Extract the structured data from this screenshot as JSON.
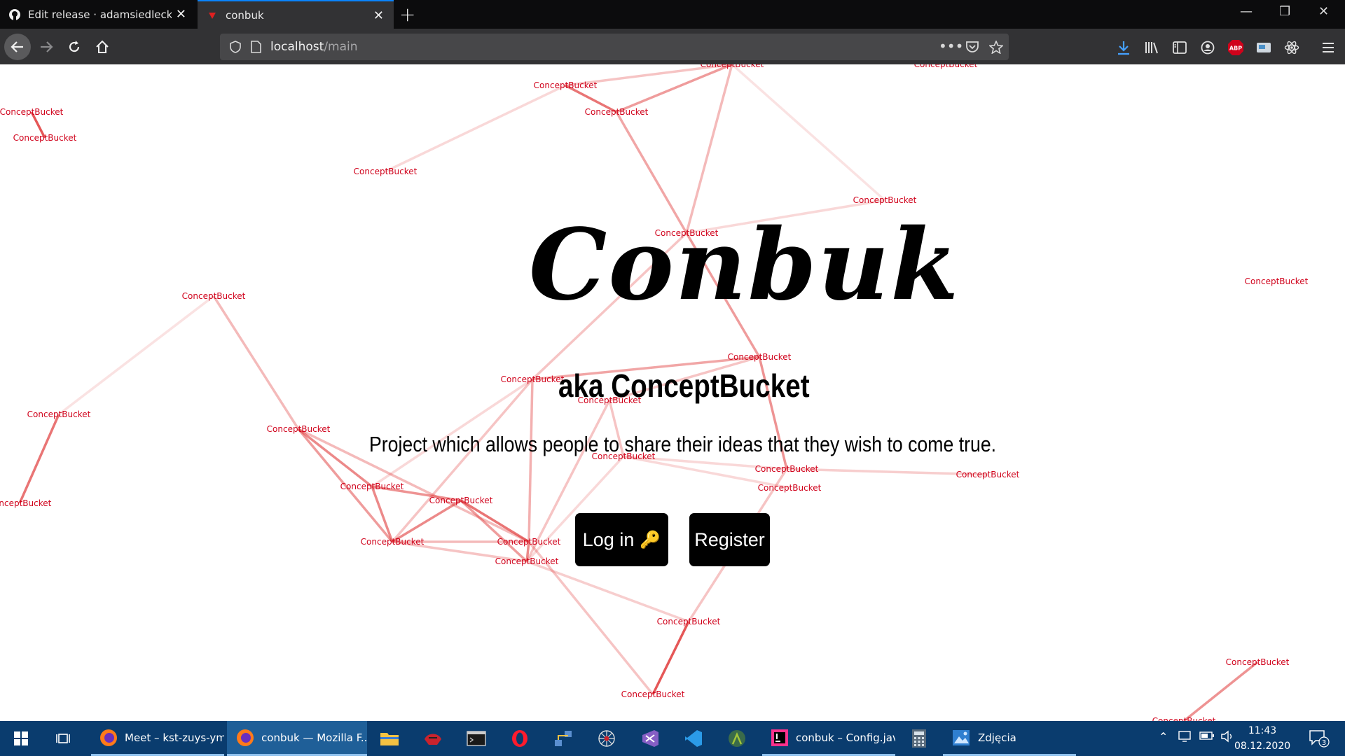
{
  "browser": {
    "tabs": [
      {
        "title": "Edit release · adamsiedlecky/conbuk",
        "favicon": "github-icon",
        "active": false
      },
      {
        "title": "conbuk",
        "favicon": "conbuk-favicon",
        "active": true
      }
    ],
    "url_host": "localhost",
    "url_path": "/main",
    "toolbar_icons": [
      "downloads-icon",
      "library-icon",
      "sidebar-icon",
      "account-icon",
      "adblock-icon",
      "extension-icon",
      "react-icon",
      "menu-icon"
    ],
    "adblock_label": "ABP"
  },
  "page": {
    "title": "Conbuk",
    "subtitle": "aka ConceptBucket",
    "description": "Project which allows people to share their ideas that they wish to come true.",
    "login_label": "Log in",
    "login_icon": "🔑",
    "register_label": "Register",
    "node_label": "ConceptBucket",
    "node_color": "#d0021b",
    "edge_color": "#e03a3a",
    "node_count": 30
  },
  "taskbar": {
    "items": [
      {
        "label": "Meet – kst-zuys-ym...",
        "icon": "firefox-icon"
      },
      {
        "label": "conbuk — Mozilla F...",
        "icon": "firefox-icon"
      },
      {
        "label": "",
        "icon": "file-explorer-icon"
      },
      {
        "label": "",
        "icon": "game-icon"
      },
      {
        "label": "",
        "icon": "terminal-icon"
      },
      {
        "label": "",
        "icon": "opera-icon"
      },
      {
        "label": "",
        "icon": "network-icon"
      },
      {
        "label": "",
        "icon": "spider-icon"
      },
      {
        "label": "",
        "icon": "visual-studio-icon"
      },
      {
        "label": "",
        "icon": "vscode-icon"
      },
      {
        "label": "",
        "icon": "android-studio-icon"
      },
      {
        "label": "conbuk – Config.jav...",
        "icon": "intellij-icon"
      },
      {
        "label": "",
        "icon": "calculator-icon"
      },
      {
        "label": "Zdjęcia",
        "icon": "photos-icon"
      }
    ],
    "time": "11:43",
    "date": "08.12.2020",
    "notifications": "3"
  }
}
